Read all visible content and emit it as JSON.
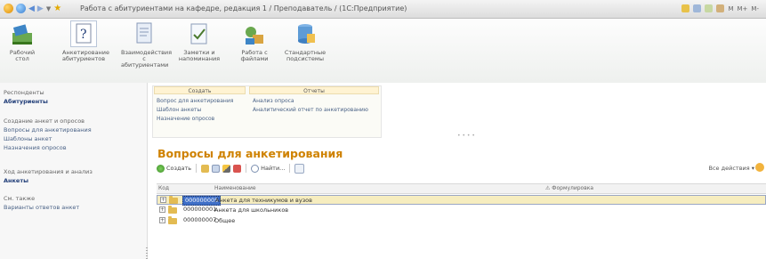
{
  "window": {
    "title": "Работа с абитуриентами на кафедре, редакция 1 / Преподаватель / (1С:Предприятие)",
    "right_indicators": [
      "M",
      "M+",
      "M-"
    ]
  },
  "ribbon": {
    "items": [
      {
        "label": "Рабочий\nстол",
        "icon": "desktop-icon"
      },
      {
        "label": "Анкетирование\nабитуриентов",
        "icon": "questionnaire-icon"
      },
      {
        "label": "Взаимодействия\nс абитуриентами",
        "icon": "interaction-icon"
      },
      {
        "label": "Заметки и\nнапоминания",
        "icon": "notes-icon"
      },
      {
        "label": "Работа с\nфайлами",
        "icon": "files-icon"
      },
      {
        "label": "Стандартные\nподсистемы",
        "icon": "standard-subsystems-icon"
      }
    ]
  },
  "left_panel": {
    "section1_header": "Респонденты",
    "section1_link": "Абитуриенты",
    "section2_header": "Создание анкет и опросов",
    "section2_links": [
      "Вопросы для анкетирования",
      "Шаблоны анкет",
      "Назначения опросов"
    ],
    "section3_header": "Ход анкетирования и анализ",
    "section3_link": "Анкеты",
    "section4_header": "См. также",
    "section4_link": "Варианты ответов анкет"
  },
  "nav_panel": {
    "create_header": "Создать",
    "create_links": [
      "Вопрос для анкетирования",
      "Шаблон анкеты",
      "Назначение опросов"
    ],
    "reports_header": "Отчеты",
    "reports_links": [
      "Анализ опроса",
      "Аналитический отчет по анкетированию"
    ]
  },
  "content": {
    "title": "Вопросы для анкетирования",
    "toolbar": {
      "create_label": "Создать",
      "find_label": "Найти..."
    },
    "all_actions_label": "Все действия ▾",
    "columns": {
      "code": "Код",
      "name": "Наименование",
      "wording": "Формулировка"
    },
    "rows": [
      {
        "code": "000000005",
        "name": "Анкета для техникумов и вузов",
        "selected": true
      },
      {
        "code": "000000001",
        "name": "Анкета для школьников",
        "selected": false
      },
      {
        "code": "000000007",
        "name": "Общее",
        "selected": false
      }
    ]
  },
  "colors": {
    "accent_title": "#cf8200",
    "selection_row": "#f6edbf",
    "selection_code": "#3f6fc7",
    "link": "#4a6286"
  }
}
